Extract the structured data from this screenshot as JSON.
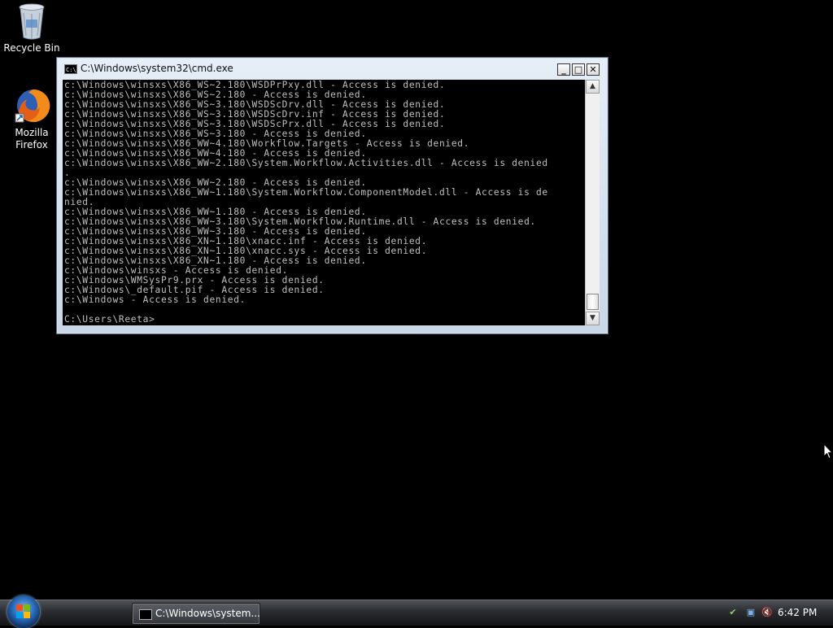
{
  "desktop": {
    "icons": [
      {
        "label": "Recycle Bin",
        "icon": "recycle-bin-icon"
      },
      {
        "label_line1": "Mozilla",
        "label_line2": "Firefox",
        "icon": "firefox-icon"
      }
    ]
  },
  "window": {
    "title": "C:\\Windows\\system32\\cmd.exe",
    "minimize": "_",
    "maximize": "□",
    "close": "✕",
    "lines": [
      "c:\\Windows\\winsxs\\X86_WS~2.180\\WSDPrPxy.dll - Access is denied.",
      "c:\\Windows\\winsxs\\X86_WS~2.180 - Access is denied.",
      "c:\\Windows\\winsxs\\X86_WS~3.180\\WSDScDrv.dll - Access is denied.",
      "c:\\Windows\\winsxs\\X86_WS~3.180\\WSDScDrv.inf - Access is denied.",
      "c:\\Windows\\winsxs\\X86_WS~3.180\\WSDScPrx.dll - Access is denied.",
      "c:\\Windows\\winsxs\\X86_WS~3.180 - Access is denied.",
      "c:\\Windows\\winsxs\\X86_WW~4.180\\Workflow.Targets - Access is denied.",
      "c:\\Windows\\winsxs\\X86_WW~4.180 - Access is denied.",
      "c:\\Windows\\winsxs\\X86_WW~2.180\\System.Workflow.Activities.dll - Access is denied",
      ".",
      "c:\\Windows\\winsxs\\X86_WW~2.180 - Access is denied.",
      "c:\\Windows\\winsxs\\X86_WW~1.180\\System.Workflow.ComponentModel.dll - Access is de",
      "nied.",
      "c:\\Windows\\winsxs\\X86_WW~1.180 - Access is denied.",
      "c:\\Windows\\winsxs\\X86_WW~3.180\\System.Workflow.Runtime.dll - Access is denied.",
      "c:\\Windows\\winsxs\\X86_WW~3.180 - Access is denied.",
      "c:\\Windows\\winsxs\\X86_XN~1.180\\xnacc.inf - Access is denied.",
      "c:\\Windows\\winsxs\\X86_XN~1.180\\xnacc.sys - Access is denied.",
      "c:\\Windows\\winsxs\\X86_XN~1.180 - Access is denied.",
      "c:\\Windows\\winsxs - Access is denied.",
      "c:\\Windows\\WMSysPr9.prx - Access is denied.",
      "c:\\Windows\\_default.pif - Access is denied.",
      "c:\\Windows - Access is denied.",
      "",
      "C:\\Users\\Reeta>"
    ]
  },
  "taskbar": {
    "task_label": "C:\\Windows\\system...",
    "clock": "6:42 PM",
    "tray_icons": [
      "safety-icon",
      "network-icon",
      "volume-muted-icon"
    ]
  }
}
